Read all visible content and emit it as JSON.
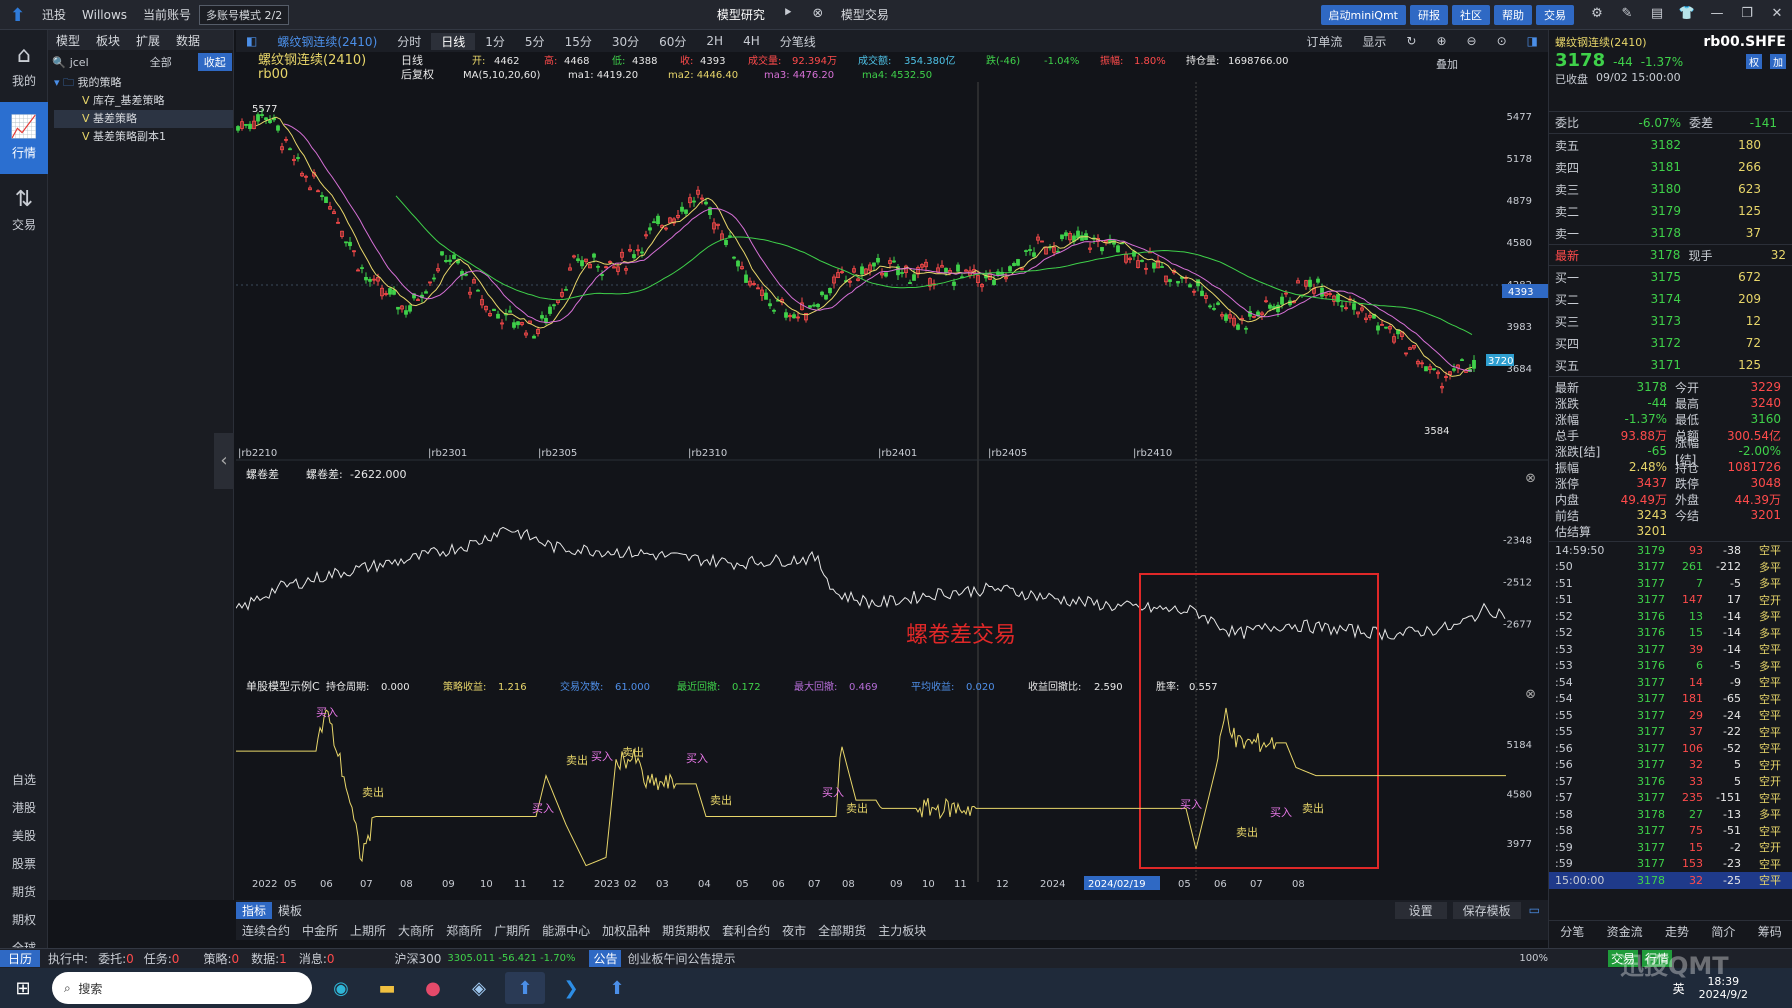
{
  "top": {
    "brand": "迅投",
    "user": "Willows",
    "account_label": "当前账号",
    "account_mode": "多账号模式 2/2",
    "model_research": "模型研究",
    "model_trade": "模型交易",
    "buttons": [
      "启动miniQmt",
      "研报",
      "社区",
      "帮助",
      "交易"
    ]
  },
  "nav": {
    "items": [
      {
        "label": "我的",
        "icon": "home-icon"
      },
      {
        "label": "行情",
        "icon": "chart-icon"
      },
      {
        "label": "交易",
        "icon": "trade-icon"
      }
    ],
    "sub": [
      "自选",
      "港股",
      "美股",
      "股票",
      "期货",
      "期权",
      "全球"
    ]
  },
  "strategy": {
    "tabs": [
      "模型",
      "板块",
      "扩展",
      "数据"
    ],
    "search": "jcel",
    "filter": "全部",
    "collapse": "收起",
    "root": "我的策略",
    "items": [
      "库存_基差策略",
      "基差策略",
      "基差策略副本1"
    ]
  },
  "chart_head": {
    "code": "螺纹钢连续(2410)",
    "periods": [
      "分时",
      "日线",
      "1分",
      "5分",
      "15分",
      "30分",
      "60分",
      "2H",
      "4H",
      "分笔线"
    ],
    "active": "日线",
    "orderflow": "订单流",
    "display": "显示"
  },
  "info": {
    "name": "螺纹钢连续(2410)",
    "code": "rb00",
    "period": "日线",
    "adj": "后复权",
    "open_l": "开:",
    "open": "4462",
    "high_l": "高:",
    "high": "4468",
    "low_l": "低:",
    "low": "4388",
    "close_l": "收:",
    "close": "4393",
    "vol_l": "成交量:",
    "vol": "92.394万",
    "amt_l": "成交额:",
    "amt": "354.380亿",
    "chg_l": "跌(-46)",
    "pct": "-1.04%",
    "amp_l": "振幅:",
    "amp": "1.80%",
    "oi_l": "持仓量:",
    "oi": "1698766.00",
    "ma_l": "MA(5,10,20,60)",
    "ma1": "ma1: 4419.20",
    "ma2": "ma2: 4446.40",
    "ma3": "ma3: 4476.20",
    "ma4": "ma4: 4532.50",
    "overlay": "叠加"
  },
  "price_axis": [
    "5477",
    "5178",
    "4879",
    "4580",
    "4282",
    "3983",
    "3684"
  ],
  "price_tag": "4393",
  "price_tag2": "3720",
  "high_label": "5577",
  "low_label": "3584",
  "contracts": [
    "rb2210",
    "rb2301",
    "rb2305",
    "rb2310",
    "rb2401",
    "rb2405",
    "rb2410"
  ],
  "spread": {
    "title": "螺卷差",
    "label": "螺卷差:",
    "value": "-2622.000",
    "axis": [
      "-2348",
      "-2512",
      "-2677"
    ],
    "annotation": "螺卷差交易"
  },
  "model": {
    "name": "单股模型示例C",
    "stats": [
      {
        "k": "持仓周期:",
        "v": "0.000",
        "c": "white"
      },
      {
        "k": "策略收益:",
        "v": "1.216",
        "c": "yellow"
      },
      {
        "k": "交易次数:",
        "v": "61.000",
        "c": "cyan"
      },
      {
        "k": "最近回撤:",
        "v": "0.172",
        "c": "green"
      },
      {
        "k": "最大回撤:",
        "v": "0.469",
        "c": "purple"
      },
      {
        "k": "平均收益:",
        "v": "0.020",
        "c": "cyan"
      },
      {
        "k": "收益回撤比:",
        "v": "2.590",
        "c": "white"
      },
      {
        "k": "胜率:",
        "v": "0.557",
        "c": "white"
      }
    ],
    "axis": [
      "5184",
      "4580",
      "3977"
    ],
    "buy": "买入",
    "sell": "卖出"
  },
  "xaxis": [
    "2022",
    "05",
    "06",
    "07",
    "08",
    "09",
    "10",
    "11",
    "12",
    "2023",
    "02",
    "03",
    "04",
    "05",
    "06",
    "07",
    "08",
    "09",
    "10",
    "11",
    "12",
    "2024",
    "2024/02/19",
    "05",
    "06",
    "07",
    "08"
  ],
  "bottom_tabs": [
    "指标",
    "模板"
  ],
  "bottom_btns": [
    "设置",
    "保存模板"
  ],
  "exchanges": [
    "连续合约",
    "中金所",
    "上期所",
    "大商所",
    "郑商所",
    "广期所",
    "能源中心",
    "加权品种",
    "期货期权",
    "套利合约",
    "夜市",
    "全部期货",
    "主力板块"
  ],
  "quote": {
    "name": "螺纹钢连续(2410)",
    "code": "rb00.SHFE",
    "last": "3178",
    "chg": "-44",
    "pct": "-1.37%",
    "status": "已收盘",
    "time": "09/02  15:00:00",
    "weibi_l": "委比",
    "weibi": "-6.07%",
    "weicha_l": "委差",
    "weicha": "-141",
    "asks": [
      [
        "卖五",
        "3182",
        "180"
      ],
      [
        "卖四",
        "3181",
        "266"
      ],
      [
        "卖三",
        "3180",
        "623"
      ],
      [
        "卖二",
        "3179",
        "125"
      ],
      [
        "卖一",
        "3178",
        "37"
      ]
    ],
    "latest": [
      "最新",
      "3178",
      "现手",
      "32"
    ],
    "bids": [
      [
        "买一",
        "3175",
        "672"
      ],
      [
        "买二",
        "3174",
        "209"
      ],
      [
        "买三",
        "3173",
        "12"
      ],
      [
        "买四",
        "3172",
        "72"
      ],
      [
        "买五",
        "3171",
        "125"
      ]
    ],
    "stats": [
      [
        "最新",
        "3178",
        "今开",
        "3229"
      ],
      [
        "涨跌",
        "-44",
        "最高",
        "3240"
      ],
      [
        "涨幅",
        "-1.37%",
        "最低",
        "3160"
      ],
      [
        "总手",
        "93.88万",
        "总额",
        "300.54亿"
      ],
      [
        "涨跌[结]",
        "-65",
        "涨幅[结]",
        "-2.00%"
      ],
      [
        "振幅",
        "2.48%",
        "持仓",
        "1081726"
      ],
      [
        "涨停",
        "3437",
        "跌停",
        "3048"
      ],
      [
        "内盘",
        "49.49万",
        "外盘",
        "44.39万"
      ],
      [
        "前结",
        "3243",
        "今结",
        "3201"
      ],
      [
        "估结算",
        "3201",
        "",
        ""
      ]
    ],
    "ticks": [
      [
        "14:59:50",
        "3179",
        "93",
        "-38",
        "空平"
      ],
      [
        ":50",
        "3177",
        "261",
        "-212",
        "多平"
      ],
      [
        ":51",
        "3177",
        "7",
        "-5",
        "多平"
      ],
      [
        ":51",
        "3177",
        "147",
        "17",
        "空开"
      ],
      [
        ":52",
        "3176",
        "13",
        "-14",
        "多平"
      ],
      [
        ":52",
        "3176",
        "15",
        "-14",
        "多平"
      ],
      [
        ":53",
        "3177",
        "39",
        "-14",
        "空平"
      ],
      [
        ":53",
        "3176",
        "6",
        "-5",
        "多平"
      ],
      [
        ":54",
        "3177",
        "14",
        "-9",
        "空平"
      ],
      [
        ":54",
        "3177",
        "181",
        "-65",
        "空平"
      ],
      [
        ":55",
        "3177",
        "29",
        "-24",
        "空平"
      ],
      [
        ":55",
        "3177",
        "37",
        "-22",
        "空平"
      ],
      [
        ":56",
        "3177",
        "106",
        "-52",
        "空平"
      ],
      [
        ":56",
        "3177",
        "32",
        "5",
        "空开"
      ],
      [
        ":57",
        "3176",
        "33",
        "5",
        "空开"
      ],
      [
        ":57",
        "3177",
        "235",
        "-151",
        "空平"
      ],
      [
        ":58",
        "3178",
        "27",
        "-13",
        "多平"
      ],
      [
        ":58",
        "3177",
        "75",
        "-51",
        "空平"
      ],
      [
        ":59",
        "3177",
        "15",
        "-2",
        "空开"
      ],
      [
        ":59",
        "3177",
        "153",
        "-23",
        "空平"
      ],
      [
        "15:00:00",
        "3178",
        "32",
        "-25",
        "空平"
      ]
    ],
    "btabs": [
      "分笔",
      "资金流",
      "走势",
      "简介",
      "筹码"
    ]
  },
  "status": {
    "items": [
      "日历",
      "执行中:",
      "委托:",
      "0",
      "任务:",
      "0",
      "策略:",
      "0",
      "数据:",
      "1",
      "消息:",
      "0"
    ],
    "index": "沪深300",
    "index_v": "3305.011  -56.421  -1.70%",
    "notice": "公告",
    "notice_text": "创业板午间公告提示",
    "zoom": "100%",
    "trade": "交易",
    "quote": "行情"
  },
  "taskbar": {
    "search": "搜索",
    "time": "18:39",
    "date": "2024/9/2",
    "lang": "英",
    "watermark": "迅投QMT"
  }
}
